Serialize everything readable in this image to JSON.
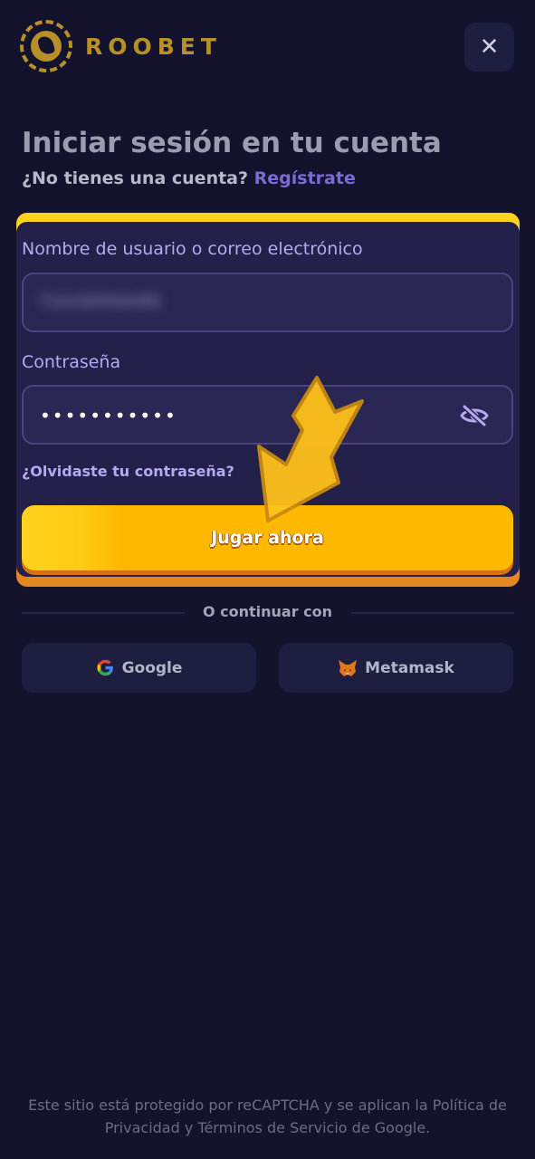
{
  "header": {
    "brand": "ROOBET",
    "close_symbol": "✕"
  },
  "login": {
    "title": "Iniciar sesión en tu cuenta",
    "subtitle_prefix": "¿No tienes una cuenta?",
    "register_link": "Regístrate",
    "username_label": "Nombre de usuario o correo electrónico",
    "username_value": "TUUSERNAME",
    "password_label": "Contraseña",
    "password_value": "•••••••••••",
    "forgot_link": "¿Olvidaste tu contraseña?",
    "submit_label": "Jugar ahora"
  },
  "alt_login": {
    "divider_text": "O continuar con",
    "google_label": "Google",
    "metamask_label": "Metamask"
  },
  "footer": {
    "text": "Este sitio está protegido por reCAPTCHA y se aplican la Política de Privacidad y Términos de Servicio de Google."
  },
  "colors": {
    "background": "#13132e",
    "accent_yellow": "#ffb800",
    "accent_purple": "#7d6ad6",
    "brand_gold": "#b7902a"
  },
  "icons": [
    "roobet-logo-icon",
    "close-icon",
    "eye-off-icon",
    "google-icon",
    "metamask-icon",
    "pointer-arrow-icon"
  ]
}
